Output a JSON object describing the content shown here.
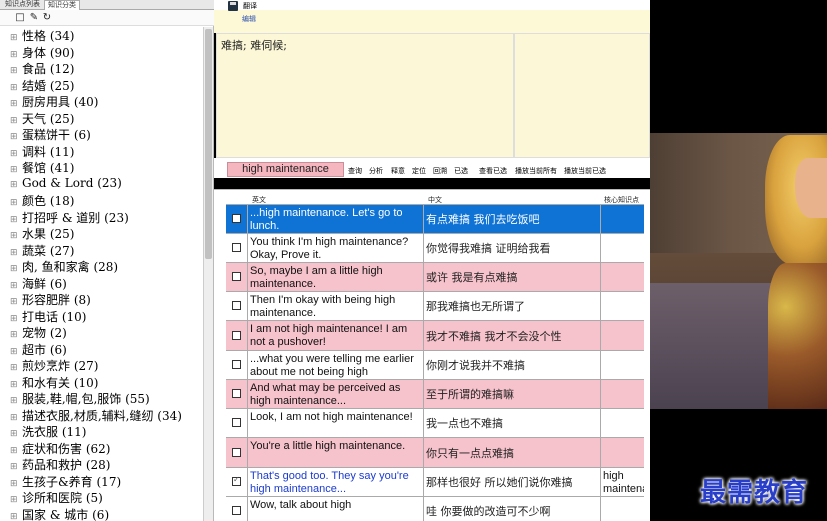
{
  "left_panel": {
    "tabs": [
      "知识点列表",
      "知识分类"
    ],
    "toolbar_icons": [
      "new-icon",
      "edit-icon",
      "refresh-icon"
    ],
    "categories": [
      "性格 (34)",
      "身体 (90)",
      "食品 (12)",
      "结婚 (25)",
      "厨房用具 (40)",
      "天气 (25)",
      "蛋糕饼干 (6)",
      "调料 (11)",
      "餐馆 (41)",
      "God & Lord (23)",
      "颜色 (18)",
      "打招呼 & 道别 (23)",
      "水果 (25)",
      "蔬菜 (27)",
      "肉, 鱼和家禽 (28)",
      "海鲜 (6)",
      "形容肥胖 (8)",
      "打电话 (10)",
      "宠物 (2)",
      "超市 (6)",
      "煎炒烹炸 (27)",
      "和水有关 (10)",
      "服装,鞋,帽,包,服饰 (55)",
      "描述衣服,材质,辅料,缝纫 (34)",
      "洗衣服 (11)",
      "症状和伤害 (62)",
      "药品和救护 (28)",
      "生孩子&养育 (17)",
      "诊所和医院 (5)",
      "国家 & 城市 (6)"
    ]
  },
  "top": {
    "translate_label": "翻译",
    "edit_label": "编辑"
  },
  "translation": {
    "text": "难搞; 难伺候;"
  },
  "search": {
    "query": "high maintenance",
    "buttons": [
      "查询",
      "分析",
      "释意",
      "定位",
      "回溯",
      "已选",
      "查看已选",
      "播放当前所有",
      "播放当前已选"
    ]
  },
  "results": {
    "tab_label": "查询结果",
    "headers": [
      "英文",
      "中文",
      "核心知识点"
    ],
    "rows": [
      {
        "en": "...high maintenance. Let's go to lunch.",
        "zh": "有点难搞  我们去吃饭吧",
        "core": "",
        "style": "selected",
        "checked": false
      },
      {
        "en": "You think I'm high maintenance? Okay, Prove it.",
        "zh": "你觉得我难搞  证明给我看",
        "core": "",
        "style": "white",
        "checked": false
      },
      {
        "en": "So, maybe I am a little high maintenance.",
        "zh": "或许  我是有点难搞",
        "core": "",
        "style": "pink",
        "checked": false
      },
      {
        "en": "Then I'm okay with being high maintenance.",
        "zh": "那我难搞也无所谓了",
        "core": "",
        "style": "white",
        "checked": false
      },
      {
        "en": "I am not high maintenance! I am not a pushover!",
        "zh": "我才不难搞  我才不会没个性",
        "core": "",
        "style": "pink",
        "checked": false
      },
      {
        "en": "...what you were telling me earlier about me not being high",
        "zh": "你刚才说我并不难搞",
        "core": "",
        "style": "white",
        "checked": false
      },
      {
        "en": "And what may be perceived as high maintenance...",
        "zh": "至于所谓的难搞嘛",
        "core": "",
        "style": "pink",
        "checked": false
      },
      {
        "en": "Look, I am not high maintenance!",
        "zh": "我一点也不难搞",
        "core": "",
        "style": "white",
        "checked": false
      },
      {
        "en": "You're a little high maintenance.",
        "zh": "你只有一点点难搞",
        "core": "",
        "style": "pink",
        "checked": false
      },
      {
        "en": "That's good too. They say you're high maintenance...",
        "zh": "那样也很好  所以她们说你难搞",
        "core": "high maintenance",
        "style": "blue",
        "checked": true
      },
      {
        "en": "Wow, talk about high",
        "zh": "哇  你要做的改造可不少啊",
        "core": "",
        "style": "white",
        "checked": false
      }
    ]
  },
  "colors": {
    "selected_row": "#0f73d6",
    "pink_row": "#f6c2cb",
    "note_bg": "#fcf8d7",
    "blue_text": "#1b3bd1",
    "watermark": "#2a3fc9"
  },
  "watermark": {
    "text": "最需教育"
  }
}
